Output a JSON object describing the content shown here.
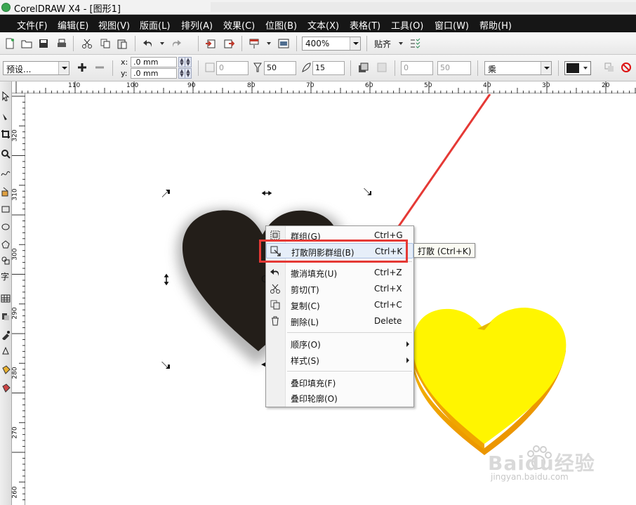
{
  "window": {
    "title": "CorelDRAW X4 - [图形1]"
  },
  "menu": [
    "文件(F)",
    "编辑(E)",
    "视图(V)",
    "版面(L)",
    "排列(A)",
    "效果(C)",
    "位图(B)",
    "文本(X)",
    "表格(T)",
    "工具(O)",
    "窗口(W)",
    "帮助(H)"
  ],
  "toolbar": {
    "zoom": "400%",
    "snap_label": "贴齐"
  },
  "property_bar": {
    "preset": "预设...",
    "x_label": "x:",
    "x_value": ".0 mm",
    "y_label": "y:",
    "y_value": ".0 mm",
    "offset_value": "0",
    "opacity_value": "50",
    "feather_value": "15",
    "fade_value": "0",
    "stretch_value": "50",
    "merge_mode": "乘"
  },
  "ruler": {
    "h_ticks": [
      "110",
      "100",
      "90",
      "80",
      "70",
      "60",
      "50",
      "40",
      "30",
      "20"
    ],
    "v_ticks": [
      "320",
      "310",
      "300",
      "290",
      "280",
      "270",
      "260"
    ]
  },
  "context_menu": {
    "items": [
      {
        "label": "群组(G)",
        "shortcut": "Ctrl+G"
      },
      {
        "label": "打散阴影群组(B)",
        "shortcut": "Ctrl+K"
      },
      {
        "label": "撤消填充(U)",
        "shortcut": "Ctrl+Z"
      },
      {
        "label": "剪切(T)",
        "shortcut": "Ctrl+X"
      },
      {
        "label": "复制(C)",
        "shortcut": "Ctrl+C"
      },
      {
        "label": "删除(L)",
        "shortcut": "Delete"
      },
      {
        "label": "顺序(O)",
        "shortcut": ""
      },
      {
        "label": "样式(S)",
        "shortcut": ""
      },
      {
        "label": "叠印填充(F)",
        "shortcut": ""
      },
      {
        "label": "叠印轮廓(O)",
        "shortcut": ""
      }
    ]
  },
  "tooltip": "打散 (Ctrl+K)",
  "canvas": {
    "fragment_text": "C"
  },
  "watermark": {
    "logo": "Baidu经验",
    "url": "jingyan.baidu.com"
  },
  "colors": {
    "heart_dark": "#231e19",
    "heart_yellow": "#fff500",
    "annotation_red": "#e53935"
  }
}
